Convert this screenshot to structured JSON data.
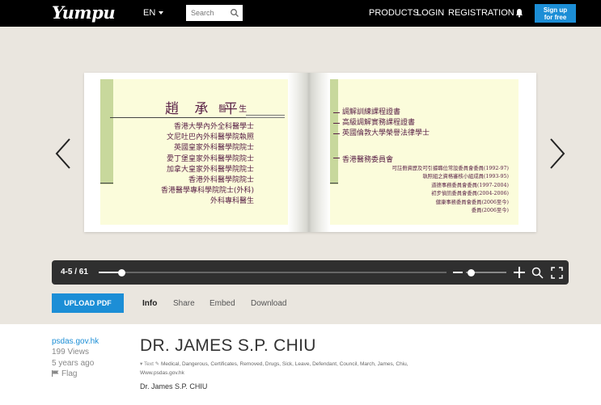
{
  "header": {
    "logo": "Yumpu",
    "language": "EN",
    "search_placeholder": "Search",
    "nav": [
      "PRODUCTS",
      "LOGIN",
      "REGISTRATION"
    ],
    "signup_line1": "Sign up",
    "signup_line2": "for free"
  },
  "book": {
    "name": "趙 承 平",
    "title": "醫 生",
    "credentials": [
      "香港大學內外全科醫學士",
      "文尼吐巴內外科醫學院執照",
      "英國皇家外科醫學院院士",
      "愛丁堡皇家外科醫學院院士",
      "加拿大皇家外科醫學院院士",
      "香港外科醫學院院士",
      "香港醫學專科學院院士(外科)",
      "外科專科醫生"
    ],
    "right_lines": [
      "調解訓練課程證書",
      "高級調解實務課程證書",
      "英國倫敦大學榮譽法律學士"
    ],
    "committee_title": "香港醫務委員會",
    "committee_items": [
      "可註冊資歷及可引據職位常設委員會委員(1992-97)",
      "執照組之資格審核小組成員(1993-95)",
      "道德事務委員會委員(1997-2004)",
      "初步偵訊委員會委員(2004-2006)",
      "健康事務委員會委員(2006至今)",
      "委員(2006至今)"
    ]
  },
  "viewer": {
    "page_indicator": "4-5 / 61",
    "progress": 0.065,
    "zoom_level": 0.05
  },
  "actions": {
    "upload_label": "UPLOAD PDF",
    "tabs": [
      "Info",
      "Share",
      "Embed",
      "Download"
    ]
  },
  "info": {
    "site": "psdas.gov.hk",
    "views": "199 Views",
    "age": "5 years ago",
    "flag": "Flag",
    "title": "DR. JAMES S.P. CHIU",
    "tag_type": "Text",
    "tags": "Medical, Dangerous, Certificates, Removed, Drugs, Sick, Leave, Defendant, Council, March, James, Chiu,",
    "tag_site": "Www.psdas.gov.hk",
    "description": "Dr. James S.P. CHIU"
  },
  "colors": {
    "accent": "#1c8ed6",
    "topbar": "#000000",
    "page_text": "#5a2146",
    "page_bg": "#fbfcdb",
    "strip": "#c8d89c"
  }
}
